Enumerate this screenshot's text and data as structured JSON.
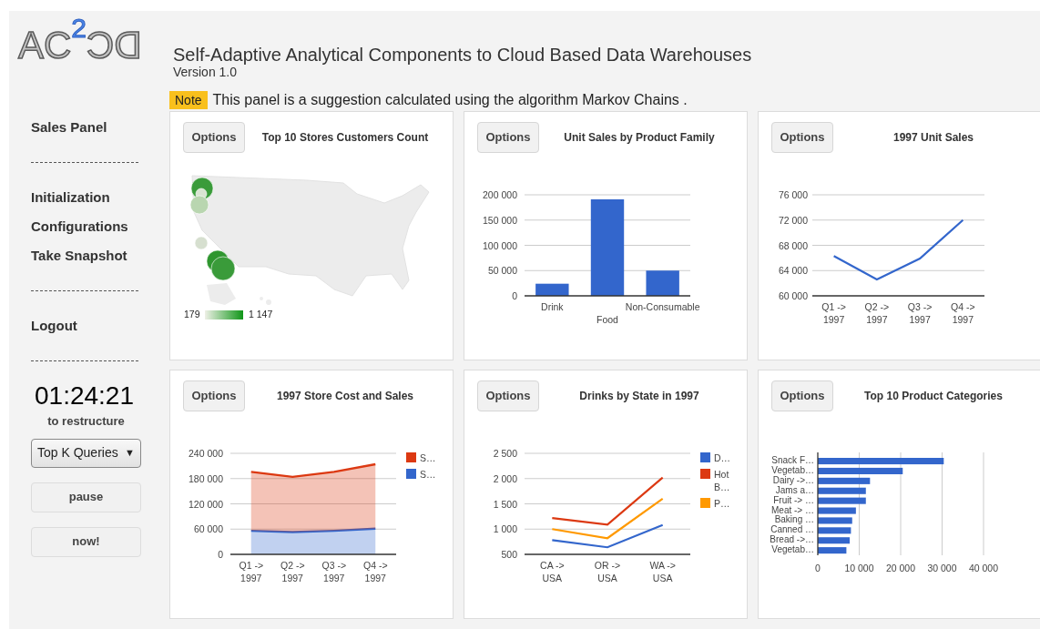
{
  "logo": {
    "text": "AC",
    "superscript": "2",
    "mirrored_text": "DC"
  },
  "header": {
    "title": "Self-Adaptive Analytical Components to Cloud Based Data Warehouses",
    "version": "Version 1.0",
    "note": {
      "badge": "Note",
      "text": "This panel is a suggestion calculated using the algorithm Markov Chains ."
    }
  },
  "sidebar": {
    "items": [
      {
        "kind": "link",
        "label": "Sales Panel"
      },
      {
        "kind": "divider"
      },
      {
        "kind": "link",
        "label": "Initialization"
      },
      {
        "kind": "link",
        "label": "Configurations"
      },
      {
        "kind": "link",
        "label": "Take Snapshot"
      },
      {
        "kind": "divider"
      },
      {
        "kind": "link",
        "label": "Logout"
      },
      {
        "kind": "divider"
      }
    ],
    "timer": "01:24:21",
    "timer_caption": "to restructure",
    "select": {
      "value": "Top K Queries",
      "arrow": "▼"
    },
    "buttons": [
      "pause",
      "now!"
    ]
  },
  "panels": [
    {
      "kind": "map",
      "button": "Options",
      "title": "Top 10 Stores Customers Count",
      "legend": {
        "min": "179",
        "max": "1 147"
      }
    },
    {
      "kind": "chart",
      "button": "Options",
      "title": "Unit Sales by Product Family",
      "chart_data": {
        "type": "bar",
        "grid": true,
        "categories": [
          "Drink",
          "Food",
          "Non-Consumable"
        ],
        "values": [
          24000,
          191000,
          50000
        ],
        "ylim": [
          0,
          200000
        ],
        "yticks": [
          {
            "value": 0,
            "label": "0"
          },
          {
            "value": 50000,
            "label": "50 000"
          },
          {
            "value": 100000,
            "label": "100 000"
          },
          {
            "value": 150000,
            "label": "150 000"
          },
          {
            "value": 200000,
            "label": "200 000"
          }
        ]
      }
    },
    {
      "kind": "chart",
      "button": "Options",
      "title": "1997 Unit Sales",
      "chart_data": {
        "type": "line",
        "grid": true,
        "categories": [
          "Q1 -> 1997",
          "Q2 -> 1997",
          "Q3 -> 1997",
          "Q4 -> 1997"
        ],
        "values": [
          66300,
          62600,
          65900,
          72000
        ],
        "ylim": [
          60000,
          76000
        ],
        "yticks": [
          {
            "value": 60000,
            "label": "60 000"
          },
          {
            "value": 64000,
            "label": "64 000"
          },
          {
            "value": 68000,
            "label": "68 000"
          },
          {
            "value": 72000,
            "label": "72 000"
          },
          {
            "value": 76000,
            "label": "76 000"
          }
        ]
      }
    },
    {
      "kind": "chart",
      "button": "Options",
      "title": "1997 Store Cost and Sales",
      "chart_data": {
        "type": "area",
        "stacked": true,
        "grid": true,
        "legend": "right",
        "categories": [
          "Q1 -> 1997",
          "Q2 -> 1997",
          "Q3 -> 1997",
          "Q4 -> 1997"
        ],
        "series": [
          {
            "name": "S…",
            "color": "#3366cc",
            "values": [
              56000,
              53000,
              56000,
              61000
            ]
          },
          {
            "name": "S…",
            "color": "#dc3912",
            "values": [
              140000,
              131000,
              140000,
              153000
            ]
          }
        ],
        "ylim": [
          0,
          240000
        ],
        "yticks": [
          {
            "value": 0,
            "label": "0"
          },
          {
            "value": 60000,
            "label": "60 000"
          },
          {
            "value": 120000,
            "label": "120 000"
          },
          {
            "value": 180000,
            "label": "180 000"
          },
          {
            "value": 240000,
            "label": "240 000"
          }
        ]
      }
    },
    {
      "kind": "chart",
      "button": "Options",
      "title": "Drinks by State in 1997",
      "chart_data": {
        "type": "line",
        "grid": true,
        "legend": "right",
        "categories": [
          "CA -> USA",
          "OR -> USA",
          "WA -> USA"
        ],
        "series": [
          {
            "name": "D…",
            "color": "#3366cc",
            "values": [
              780,
              640,
              1080
            ]
          },
          {
            "name": "Hot B…",
            "color": "#dc3912",
            "values": [
              1220,
              1090,
              2020
            ]
          },
          {
            "name": "P…",
            "color": "#ff9900",
            "values": [
              1000,
              820,
              1600
            ]
          }
        ],
        "ylim": [
          500,
          2500
        ],
        "yticks": [
          {
            "value": 500,
            "label": "500"
          },
          {
            "value": 1000,
            "label": "1 000"
          },
          {
            "value": 1500,
            "label": "1 500"
          },
          {
            "value": 2000,
            "label": "2 000"
          },
          {
            "value": 2500,
            "label": "2 500"
          }
        ]
      }
    },
    {
      "kind": "chart",
      "button": "Options",
      "title": "Top 10 Product Categories",
      "chart_data": {
        "type": "bar",
        "orientation": "horizontal",
        "grid": true,
        "categories": [
          "Snack F…",
          "Vegetab…",
          "Dairy ->…",
          "Jams a…",
          "Fruit -> …",
          "Meat -> …",
          "Baking …",
          "Canned …",
          "Bread ->…",
          "Vegetab…"
        ],
        "values": [
          30400,
          20500,
          12600,
          11600,
          11600,
          9200,
          8300,
          8000,
          7700,
          6900
        ],
        "xlim": [
          0,
          40000
        ],
        "xticks": [
          {
            "value": 0,
            "label": "0"
          },
          {
            "value": 10000,
            "label": "10 000"
          },
          {
            "value": 20000,
            "label": "20 000"
          },
          {
            "value": 30000,
            "label": "30 000"
          },
          {
            "value": 40000,
            "label": "40 000"
          }
        ]
      }
    }
  ]
}
